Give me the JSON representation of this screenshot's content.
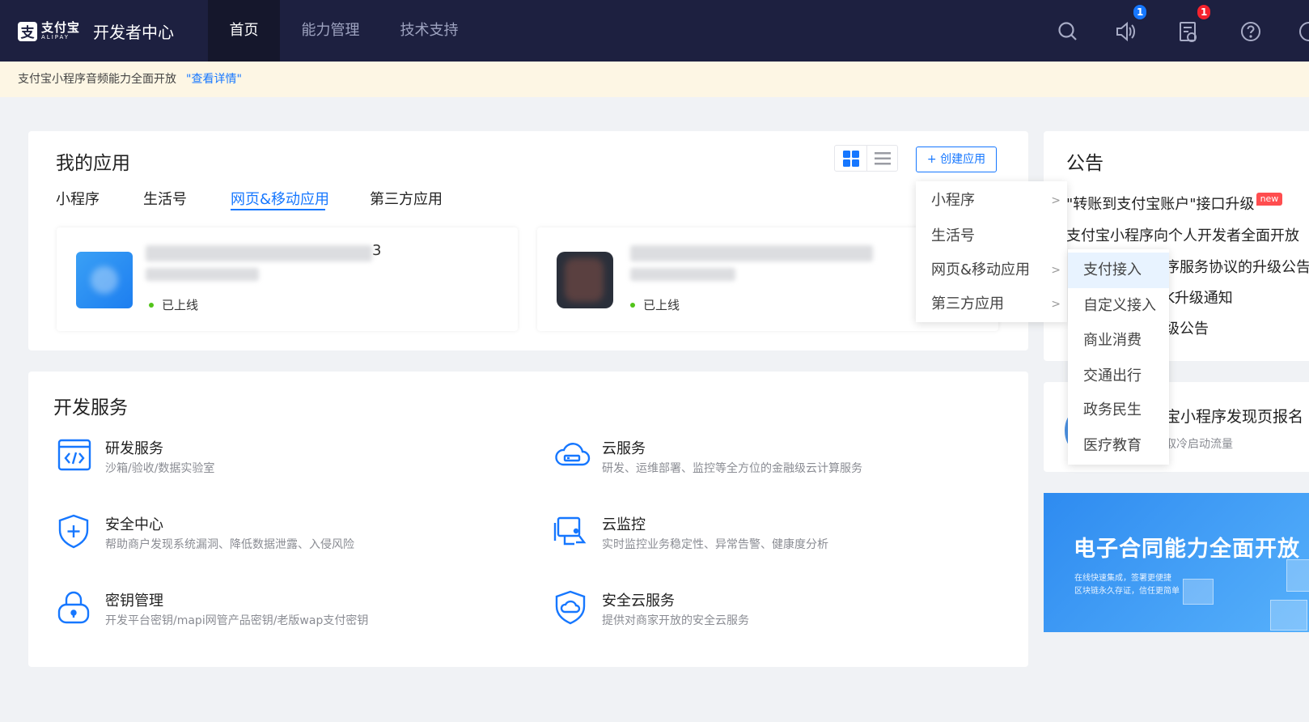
{
  "header": {
    "logo_cn": "支付宝",
    "logo_en": "ALIPAY",
    "title": "开发者中心",
    "nav": [
      {
        "label": "首页",
        "active": true
      },
      {
        "label": "能力管理",
        "active": false
      },
      {
        "label": "技术支持",
        "active": false
      }
    ],
    "icons": [
      "search-icon",
      "speaker-icon",
      "message-icon",
      "help-icon"
    ],
    "speaker_badge": "1",
    "message_badge": "1"
  },
  "notice": {
    "text": "支付宝小程序音频能力全面开放",
    "link": "\"查看详情\""
  },
  "my_apps": {
    "title": "我的应用",
    "create_label": "+ 创建应用",
    "tabs": [
      {
        "label": "小程序",
        "active": false
      },
      {
        "label": "生活号",
        "active": false
      },
      {
        "label": "网页&移动应用",
        "active": true
      },
      {
        "label": "第三方应用",
        "active": false
      }
    ],
    "apps": [
      {
        "name_suffix": "3",
        "status": "已上线"
      },
      {
        "status": "已上线"
      }
    ]
  },
  "dev_services": {
    "title": "开发服务",
    "items": [
      {
        "title": "研发服务",
        "desc": "沙箱/验收/数据实验室",
        "icon": "code-window-icon"
      },
      {
        "title": "云服务",
        "desc": "研发、运维部署、监控等全方位的金融级云计算服务",
        "icon": "cloud-icon"
      },
      {
        "title": "安全中心",
        "desc": "帮助商户发现系统漏洞、降低数据泄露、入侵风险",
        "icon": "shield-plus-icon"
      },
      {
        "title": "云监控",
        "desc": "实时监控业务稳定性、异常告警、健康度分析",
        "icon": "monitor-camera-icon"
      },
      {
        "title": "密钥管理",
        "desc": "开发平台密钥/mapi网管产品密钥/老版wap支付密钥",
        "icon": "lock-icon"
      },
      {
        "title": "安全云服务",
        "desc": "提供对商家开放的安全云服务",
        "icon": "shield-cloud-icon"
      }
    ]
  },
  "announcements": {
    "title": "公告",
    "lines": [
      "\"转账到支付宝账户\"接口升级",
      "支付宝小程序向个人开发者全面开放",
      "序服务协议的升级公告",
      "K升级通知",
      "级公告"
    ],
    "new_tag": "new"
  },
  "promo": {
    "title": "宝小程序发现页报名",
    "subtitle": "取冷启动流量"
  },
  "banner": {
    "title": "电子合同能力全面开放",
    "line1": "在线快速集成，签署更便捷",
    "line2": "区块链永久存证，信任更简单"
  },
  "create_menu": {
    "items": [
      {
        "label": "小程序",
        "has_sub": true
      },
      {
        "label": "生活号",
        "has_sub": false
      },
      {
        "label": "网页&移动应用",
        "has_sub": true
      },
      {
        "label": "第三方应用",
        "has_sub": true
      }
    ],
    "sub_items": [
      "支付接入",
      "自定义接入",
      "商业消费",
      "交通出行",
      "政务民生",
      "医疗教育"
    ],
    "sub_highlighted_index": 0
  },
  "colors": {
    "nav_bg": "#1d2040",
    "accent": "#1677ff",
    "notice_bg": "#fdf6e4",
    "online_dot": "#52c41a",
    "badge_blue": "#1677ff",
    "badge_red": "#f5222d"
  }
}
